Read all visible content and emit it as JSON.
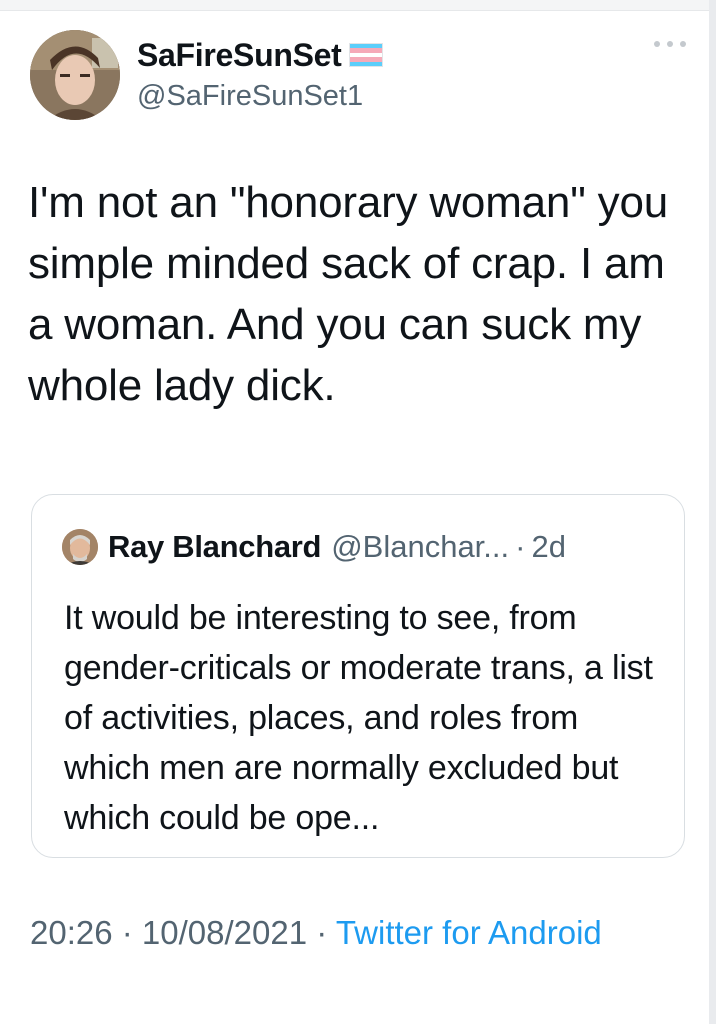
{
  "tweet": {
    "author": {
      "display_name": "SaFireSunSet",
      "handle": "@SaFireSunSet1",
      "flag_icon": "transgender-flag-icon",
      "flag_colors": [
        "#5bcefa",
        "#f5a9b8",
        "#ffffff",
        "#f5a9b8",
        "#5bcefa"
      ]
    },
    "text": "I'm not an \"honorary woman\" you simple minded sack of crap. I am a woman. And you can suck my whole lady dick.",
    "more_icon": "more-horizontal-icon",
    "quote": {
      "author_name": "Ray Blanchard",
      "author_handle": "@Blanchar...",
      "separator": "·",
      "time": "2d",
      "text": "It would be interesting to see, from gender-criticals or moderate trans, a list of activities, places, and roles from which men are normally excluded but which could be ope..."
    },
    "meta": {
      "time": "20:26",
      "sep1": " · ",
      "date": "10/08/2021",
      "sep2": " · ",
      "source": "Twitter for Android"
    }
  },
  "colors": {
    "text_primary": "#0f1419",
    "text_secondary": "#536471",
    "link": "#1d9bf0",
    "border": "#d9dee2"
  }
}
